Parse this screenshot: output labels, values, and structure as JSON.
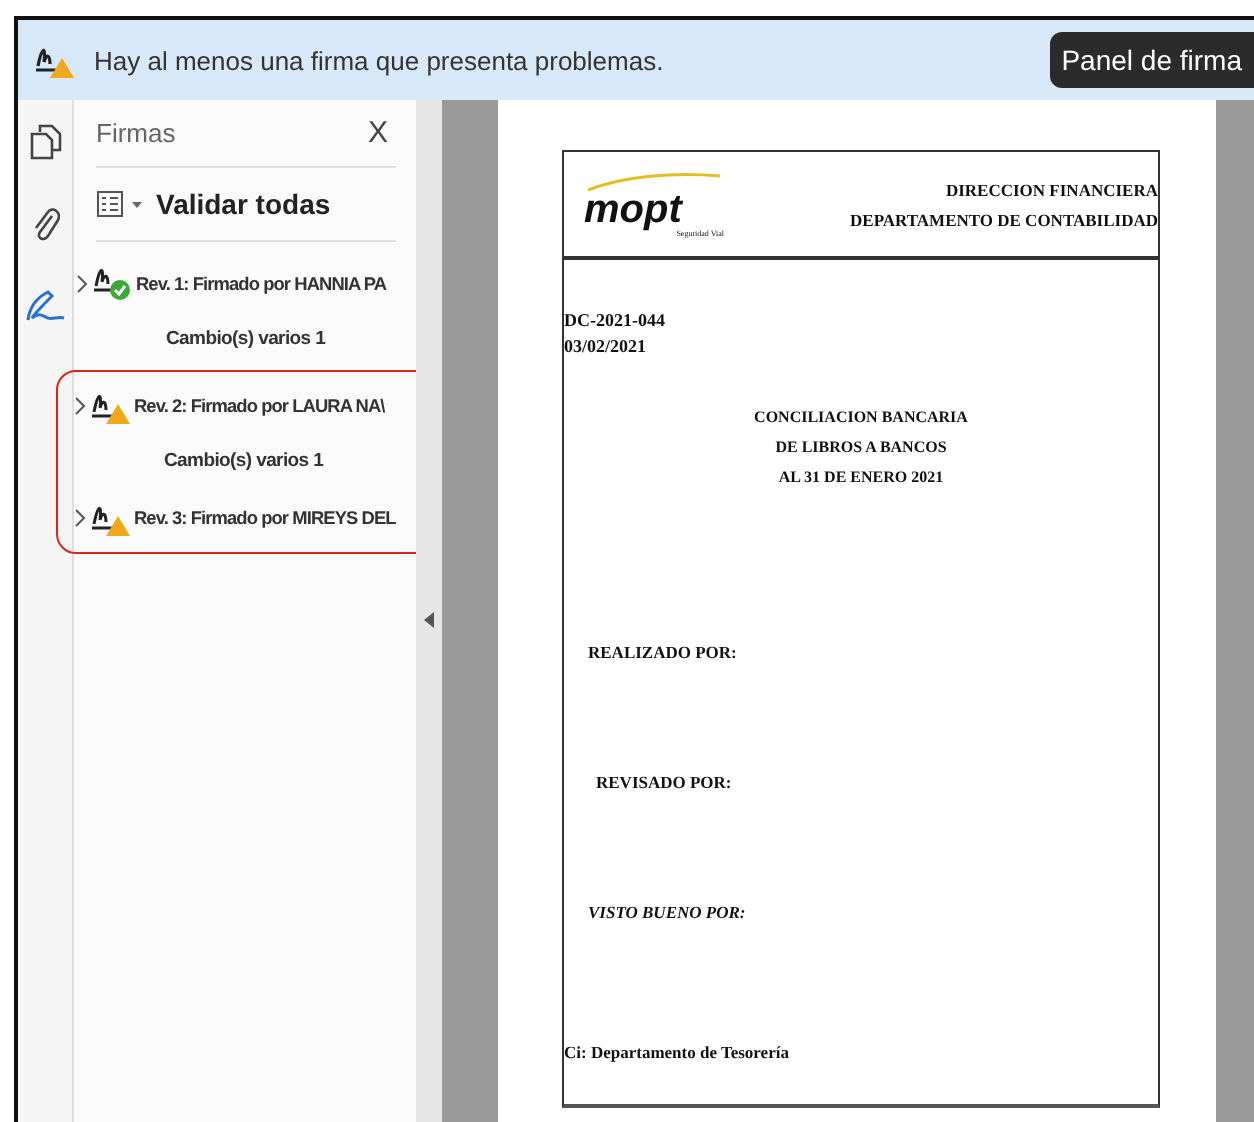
{
  "banner": {
    "message": "Hay al menos una firma que presenta problemas.",
    "button": "Panel de firma"
  },
  "panel": {
    "title": "Firmas",
    "close": "X",
    "validate_all": "Validar todas"
  },
  "signatures": [
    {
      "label": "Rev. 1: Firmado por HANNIA PA",
      "kind": "valid",
      "highlighted": false,
      "children": [
        {
          "label": "Cambio(s) varios 1"
        }
      ]
    },
    {
      "label": "Rev. 2: Firmado por LAURA NA\\",
      "kind": "warning",
      "highlighted": true,
      "children": [
        {
          "label": "Cambio(s) varios 1"
        }
      ]
    },
    {
      "label": "Rev. 3: Firmado por MIREYS DEL",
      "kind": "warning",
      "highlighted": true
    }
  ],
  "document": {
    "logo": "mopt",
    "logo_tagline": "Seguridad Vial",
    "header_lines": [
      "DIRECCION FINANCIERA",
      "DEPARTAMENTO DE CONTABILIDAD"
    ],
    "ref_lines": [
      "DC-2021-044",
      "03/02/2021"
    ],
    "title_lines": [
      "CONCILIACION BANCARIA",
      "DE LIBROS A BANCOS",
      "AL 31 DE ENERO 2021"
    ],
    "fields": [
      "REALIZADO POR:",
      "REVISADO POR:",
      "VISTO BUENO POR:"
    ],
    "cc": "Ci:  Departamento de Tesorería"
  }
}
